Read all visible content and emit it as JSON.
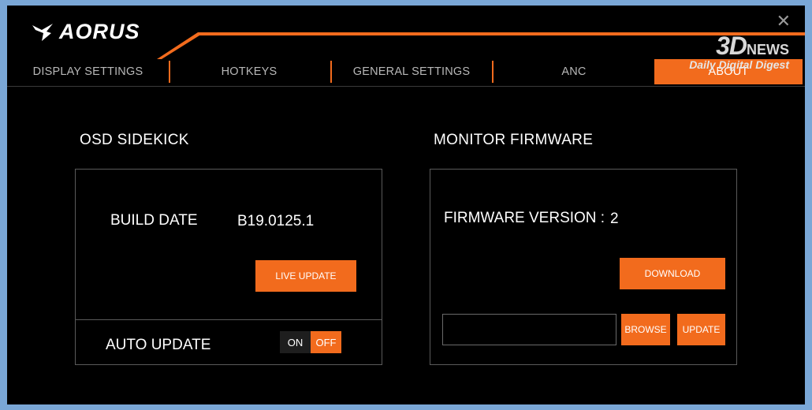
{
  "app": {
    "brand": "AORUS",
    "accent": "#f26b1d"
  },
  "tabs": [
    {
      "label": "DISPLAY SETTINGS"
    },
    {
      "label": "HOTKEYS"
    },
    {
      "label": "GENERAL SETTINGS"
    },
    {
      "label": "ANC"
    },
    {
      "label": "ABOUT",
      "active": true
    }
  ],
  "watermark": {
    "logo": "3D",
    "logo_suffix": "NEWS",
    "tagline": "Daily Digital Digest"
  },
  "osd": {
    "title": "OSD SIDEKICK",
    "build_label": "BUILD DATE",
    "build_value": "B19.0125.1",
    "live_update_label": "LIVE UPDATE",
    "auto_update_label": "AUTO UPDATE",
    "toggle_on": "ON",
    "toggle_off": "OFF",
    "toggle_state": "OFF"
  },
  "firmware": {
    "title": "MONITOR FIRMWARE",
    "version_label": "FIRMWARE VERSION :",
    "version_value": "2",
    "download_label": "DOWNLOAD",
    "browse_label": "BROWSE",
    "update_label": "UPDATE",
    "path_value": ""
  }
}
